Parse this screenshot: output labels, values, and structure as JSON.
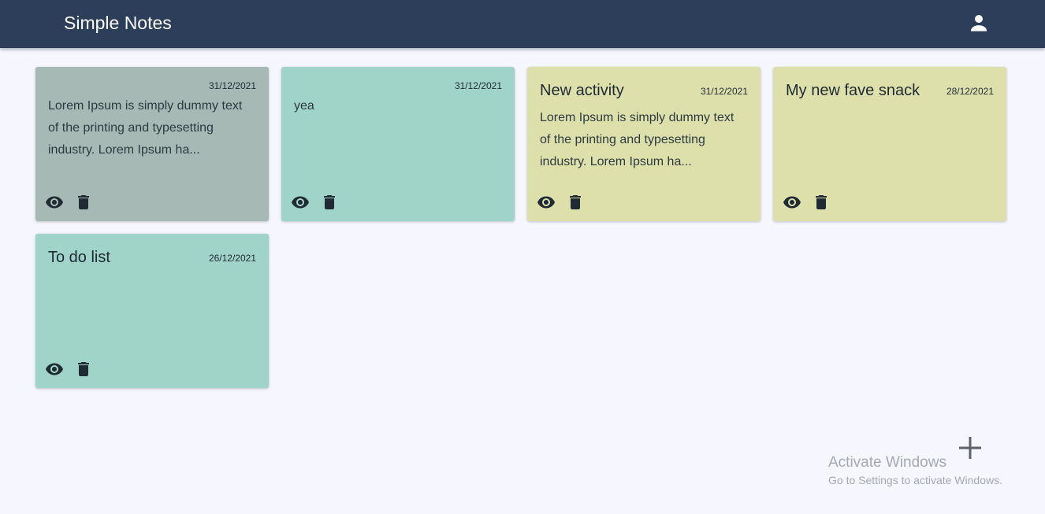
{
  "app": {
    "title": "Simple Notes",
    "colors": {
      "appbar": "#2c3e5a",
      "background": "#f5f6fe",
      "icon": "#1f2a33"
    }
  },
  "header": {
    "account_icon": "account-circle-icon"
  },
  "notes": [
    {
      "title": "",
      "date": "31/12/2021",
      "body": "Lorem Ipsum is simply dummy text of the printing and typesetting industry. Lorem Ipsum ha...",
      "color": "#a6b9b5"
    },
    {
      "title": "",
      "date": "31/12/2021",
      "body": "yea",
      "color": "#a0d4c8"
    },
    {
      "title": "New activity",
      "date": "31/12/2021",
      "body": "Lorem Ipsum is simply dummy text of the printing and typesetting industry. Lorem Ipsum ha...",
      "color": "#dee0ac"
    },
    {
      "title": "My new fave snack",
      "date": "28/12/2021",
      "body": "",
      "color": "#dee0ac"
    },
    {
      "title": "To do list",
      "date": "26/12/2021",
      "body": "",
      "color": "#a0d4c8"
    }
  ],
  "card_actions": {
    "view_icon": "eye-icon",
    "delete_icon": "trash-icon"
  },
  "fab": {
    "icon": "plus-icon"
  },
  "watermark": {
    "title": "Activate Windows",
    "subtitle": "Go to Settings to activate Windows."
  }
}
